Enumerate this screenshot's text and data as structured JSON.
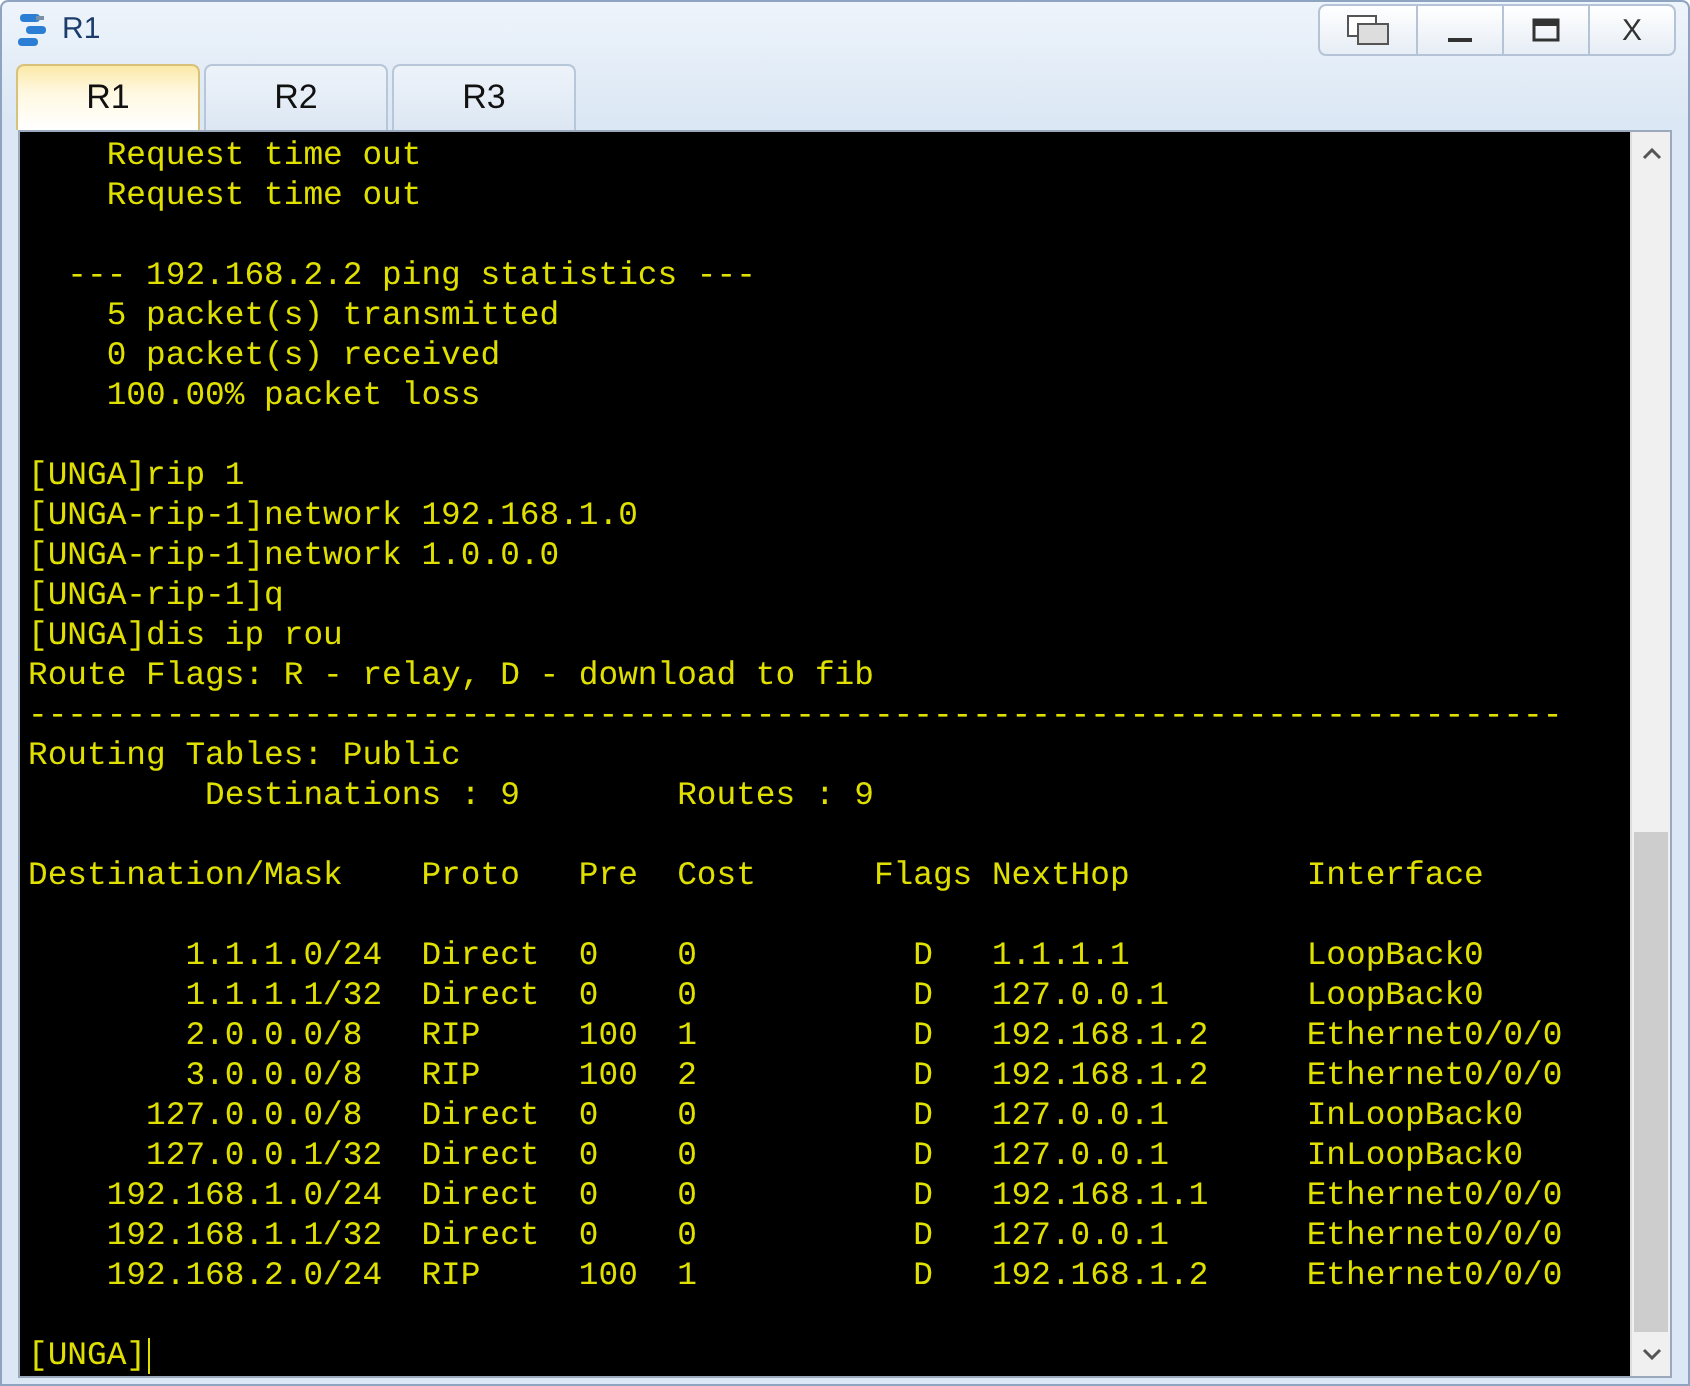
{
  "window": {
    "title": "R1",
    "controls": [
      {
        "kind": "restore"
      },
      {
        "kind": "minimize"
      },
      {
        "kind": "maximize"
      },
      {
        "kind": "close",
        "label": "X"
      }
    ]
  },
  "tabs": [
    {
      "label": "R1",
      "selected": true
    },
    {
      "label": "R2",
      "selected": false
    },
    {
      "label": "R3",
      "selected": false
    }
  ],
  "terminal": {
    "blocks": [
      [
        "    Request time out",
        "    Request time out"
      ],
      [
        "  --- 192.168.2.2 ping statistics ---",
        "    5 packet(s) transmitted",
        "    0 packet(s) received",
        "    100.00% packet loss"
      ],
      [
        "[UNGA]rip 1",
        "[UNGA-rip-1]network 192.168.1.0",
        "[UNGA-rip-1]network 1.0.0.0",
        "[UNGA-rip-1]q",
        "[UNGA]dis ip rou",
        "Route Flags: R - relay, D - download to fib",
        "------------------------------------------------------------------------------",
        "Routing Tables: Public",
        "         Destinations : 9        Routes : 9"
      ],
      [
        "Destination/Mask    Proto   Pre  Cost      Flags NextHop         Interface"
      ],
      [
        "        1.1.1.0/24  Direct  0    0           D   1.1.1.1         LoopBack0",
        "        1.1.1.1/32  Direct  0    0           D   127.0.0.1       LoopBack0",
        "        2.0.0.0/8   RIP     100  1           D   192.168.1.2     Ethernet0/0/0",
        "        3.0.0.0/8   RIP     100  2           D   192.168.1.2     Ethernet0/0/0",
        "      127.0.0.0/8   Direct  0    0           D   127.0.0.1       InLoopBack0",
        "      127.0.0.1/32  Direct  0    0           D   127.0.0.1       InLoopBack0",
        "    192.168.1.0/24  Direct  0    0           D   192.168.1.1     Ethernet0/0/0",
        "    192.168.1.1/32  Direct  0    0           D   127.0.0.1       Ethernet0/0/0",
        "    192.168.2.0/24  RIP     100  1           D   192.168.1.2     Ethernet0/0/0"
      ]
    ],
    "prompt": "[UNGA]"
  }
}
